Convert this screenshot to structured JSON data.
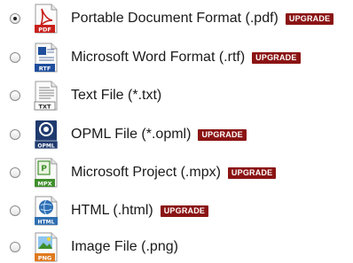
{
  "formats": [
    {
      "label": "Portable Document Format (.pdf)",
      "badge": "UPGRADE",
      "icon": "pdf-file-icon",
      "icon_text": "PDF",
      "selected": true
    },
    {
      "label": "Microsoft Word Format (.rtf)",
      "badge": "UPGRADE",
      "icon": "rtf-file-icon",
      "icon_text": "RTF",
      "selected": false
    },
    {
      "label": "Text File (*.txt)",
      "badge": "",
      "icon": "txt-file-icon",
      "icon_text": "TXT",
      "selected": false
    },
    {
      "label": "OPML File (*.opml)",
      "badge": "UPGRADE",
      "icon": "opml-file-icon",
      "icon_text": "OPML",
      "selected": false
    },
    {
      "label": "Microsoft Project (.mpx)",
      "badge": "UPGRADE",
      "icon": "mpx-file-icon",
      "icon_text": "MPX",
      "selected": false
    },
    {
      "label": "HTML (.html)",
      "badge": "UPGRADE",
      "icon": "html-file-icon",
      "icon_text": "HTML",
      "selected": false
    },
    {
      "label": "Image File (.png)",
      "badge": "",
      "icon": "png-file-icon",
      "icon_text": "PNG",
      "selected": false
    }
  ],
  "colors": {
    "badge_bg": "#8b1414",
    "pdf_red": "#c8201c",
    "rtf_blue": "#1f4e9c",
    "opml_navy": "#1f3a6e",
    "mpx_green": "#3f8f2c",
    "html_blue": "#2f6fb3",
    "png_orange": "#e07a1e"
  }
}
